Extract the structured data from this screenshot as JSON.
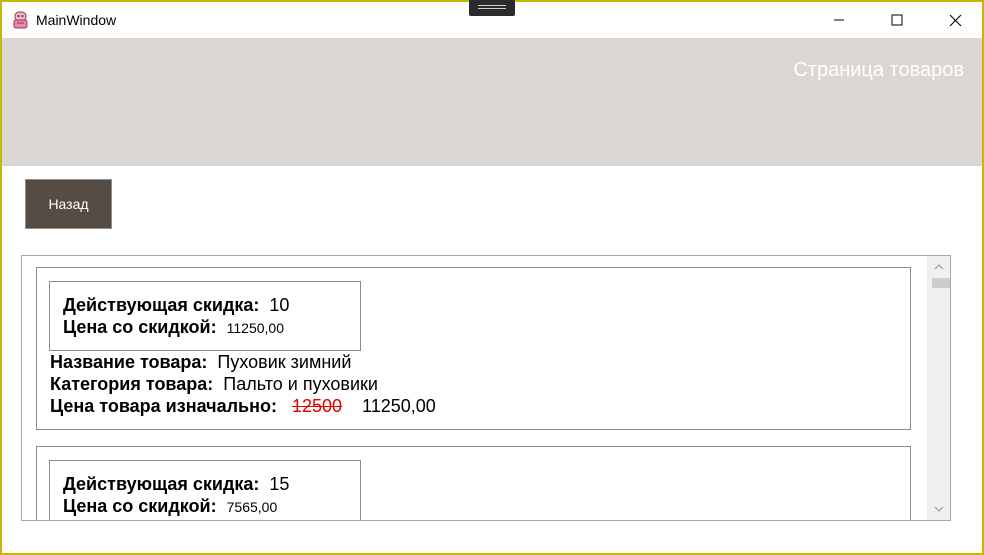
{
  "window": {
    "title": "MainWindow",
    "controls": {
      "minimize": "minimize-icon",
      "maximize": "maximize-icon",
      "close": "close-icon"
    }
  },
  "header": {
    "title": "Страница товаров",
    "background": "#dad7d2"
  },
  "toolbar": {
    "back_label": "Назад",
    "back_color": "#564c46"
  },
  "products": [
    {
      "discount_label": "Действующая скидка:",
      "discount": "10",
      "discount_price_label": "Цена со скидкой:",
      "discount_price": "11250,00",
      "name_label": "Название товара:",
      "name": "Пуховик зимний",
      "category_label": "Категория товара:",
      "category": "Пальто и пуховики",
      "price_label": "Цена товара изначально:",
      "original_price": "12500",
      "final_price": "11250,00"
    },
    {
      "discount_label": "Действующая скидка:",
      "discount": "15",
      "discount_price_label": "Цена со скидкой:",
      "discount_price": "7565,00"
    }
  ]
}
